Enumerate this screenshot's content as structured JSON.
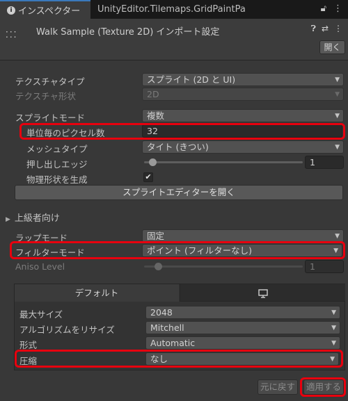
{
  "tabs": {
    "active": "インスペクター",
    "active_icon": "info-icon",
    "inactive": "UnityEditor.Tilemaps.GridPaintPa",
    "tools": [
      "lock-icon",
      "more-icon"
    ]
  },
  "header": {
    "title": "Walk Sample (Texture 2D) インポート設定",
    "open_label": "開く",
    "tools": [
      "help-icon",
      "preset-icon",
      "more-icon"
    ]
  },
  "fields": {
    "texture_type": {
      "label": "テクスチャタイプ",
      "value": "スプライト (2D と UI)"
    },
    "texture_shape": {
      "label": "テクスチャ形状",
      "value": "2D"
    },
    "sprite_mode": {
      "label": "スプライトモード",
      "value": "複数"
    },
    "pixels_per_unit": {
      "label": "単位毎のピクセル数",
      "value": "32"
    },
    "mesh_type": {
      "label": "メッシュタイプ",
      "value": "タイト (きつい)"
    },
    "extrude_edges": {
      "label": "押し出しエッジ",
      "value": "1",
      "slider_fraction": 0.03
    },
    "generate_physics": {
      "label": "物理形状を生成",
      "checked": true
    },
    "sprite_editor_button": "スプライトエディターを開く",
    "advanced": "上級者向け",
    "wrap_mode": {
      "label": "ラップモード",
      "value": "固定"
    },
    "filter_mode": {
      "label": "フィルターモード",
      "value": "ポイント (フィルターなし)"
    },
    "aniso_level": {
      "label": "Aniso Level",
      "value": "1",
      "slider_fraction": 0.07
    }
  },
  "platform": {
    "tabs": [
      "デフォルト",
      "monitor-icon"
    ],
    "max_size": {
      "label": "最大サイズ",
      "value": "2048"
    },
    "resize_algorithm": {
      "label": "アルゴリズムをリサイズ",
      "value": "Mitchell"
    },
    "format": {
      "label": "形式",
      "value": "Automatic"
    },
    "compression": {
      "label": "圧縮",
      "value": "なし"
    }
  },
  "footer": {
    "revert": "元に戻す",
    "apply": "適用する"
  },
  "highlight_color": "#e8000e"
}
